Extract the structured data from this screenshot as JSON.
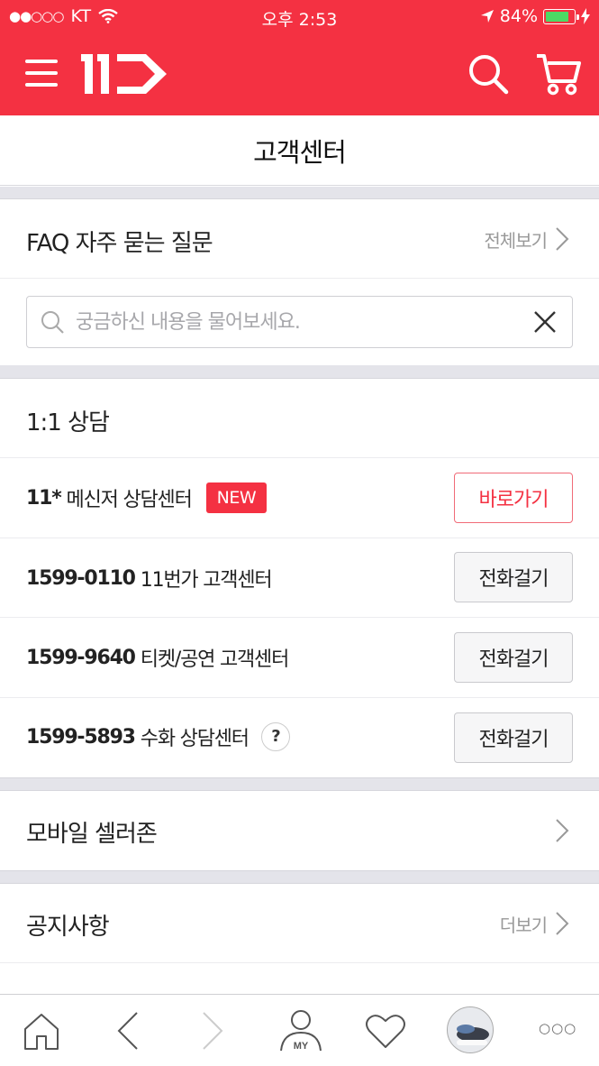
{
  "statusbar": {
    "carrier": "KT",
    "signal": "●●○○○",
    "time": "오후 2:53",
    "battery": "84%",
    "battery_level": 0.84
  },
  "header": {
    "logo_text": "11",
    "colors": {
      "brand": "#f43142"
    }
  },
  "page_title": "고객센터",
  "faq": {
    "title": "FAQ 자주 묻는 질문",
    "view_all": "전체보기",
    "search_placeholder": "궁금하신 내용을 물어보세요."
  },
  "consult": {
    "title": "1:1 상담",
    "rows": [
      {
        "bold": "11*",
        "label": "메신저 상담센터",
        "badge": "NEW",
        "button": "바로가기"
      },
      {
        "bold": "1599-0110",
        "label": "11번가 고객센터",
        "button": "전화걸기"
      },
      {
        "bold": "1599-9640",
        "label": "티켓/공연 고객센터",
        "button": "전화걸기"
      },
      {
        "bold": "1599-5893",
        "label": "수화 상담센터",
        "help": "?",
        "button": "전화걸기"
      }
    ]
  },
  "seller_zone": {
    "title": "모바일 셀러존"
  },
  "notice": {
    "title": "공지사항",
    "more": "더보기"
  },
  "bottomnav": {
    "my_label": "MY",
    "more": "○○○"
  }
}
